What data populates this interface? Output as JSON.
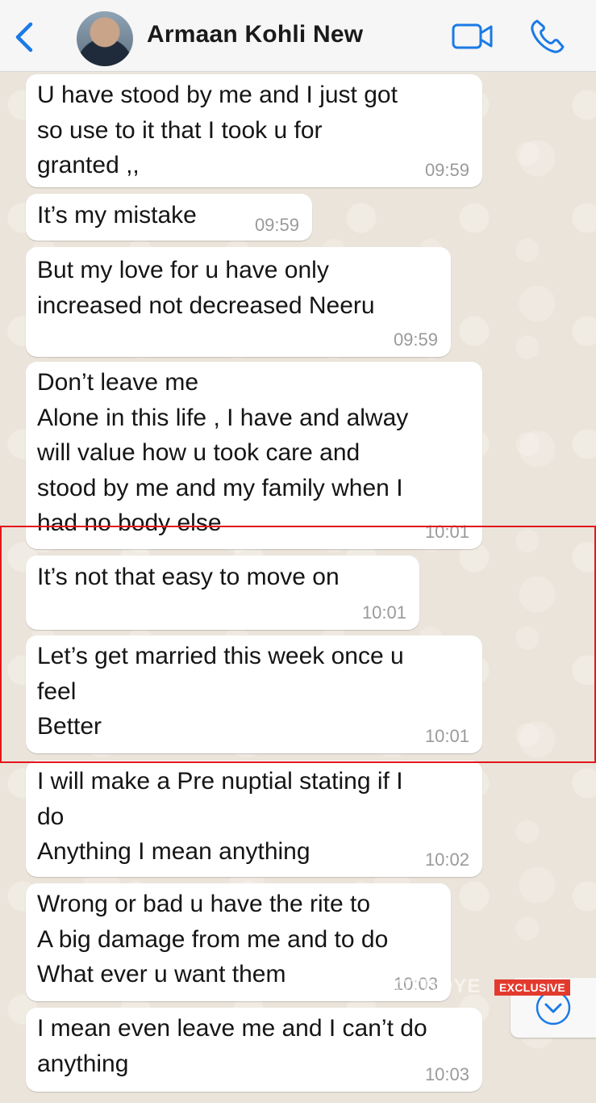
{
  "header": {
    "contact_name": "Armaan Kohli New"
  },
  "messages": [
    {
      "text": "U have stood by me and I just got\nso use to it that I took u for\ngranted ,,",
      "time": "09:59"
    },
    {
      "text": "It’s my mistake",
      "time": "09:59"
    },
    {
      "text": "But my love for u have only\nincreased not decreased Neeru",
      "time": "09:59"
    },
    {
      "text": "Don’t leave me\nAlone in this life , I have and alway\nwill value how u took care and\nstood by me and my family when I\nhad no body else",
      "time": "10:01"
    },
    {
      "text": "It’s not that easy to move on",
      "time": "10:01"
    },
    {
      "text": "Let’s get married this week once u\nfeel\nBetter",
      "time": "10:01"
    },
    {
      "text": "I will make a Pre nuptial stating if I\ndo\nAnything I mean anything",
      "time": "10:02"
    },
    {
      "text": "Wrong or bad u have the rite to\nA big damage from me and to do\nWhat ever u want them",
      "time": "10:03"
    },
    {
      "text": "I mean even leave me and I can’t do\nanything",
      "time": "10:03"
    }
  ],
  "overlay": {
    "badge": "EXCLUSIVE",
    "watermark": "SPOTBOYE"
  },
  "colors": {
    "accent": "#1a7ae6",
    "highlight": "#e3161c",
    "bubble": "#ffffff",
    "chat_background": "#ebe4da"
  },
  "icons": {
    "back": "chevron-left-icon",
    "video": "video-camera-icon",
    "call": "phone-icon",
    "scroll": "chevron-down-circle-icon"
  }
}
